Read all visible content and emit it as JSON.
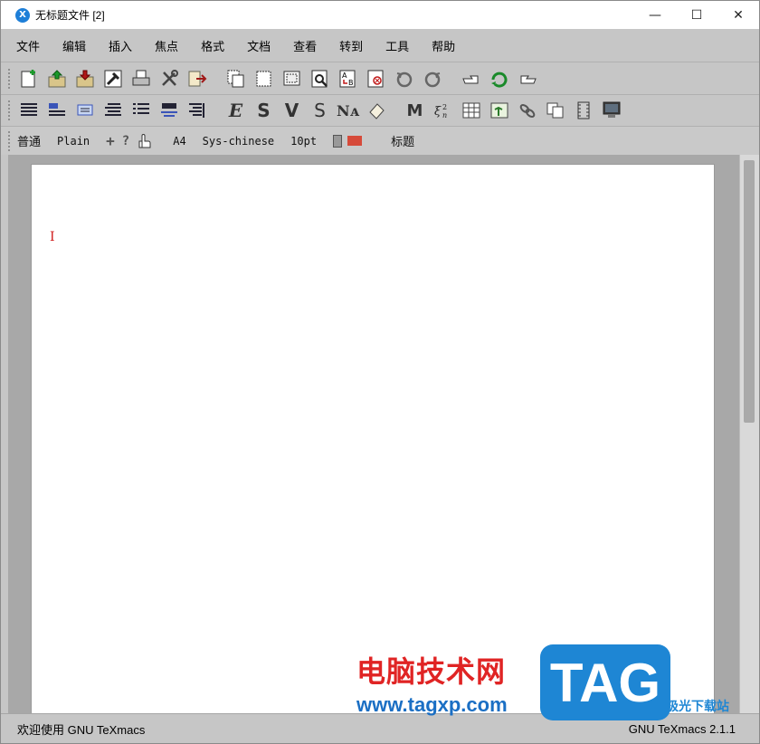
{
  "window": {
    "title": "无标题文件 [2]",
    "app_icon_glyph": "X",
    "controls": {
      "minimize": "—",
      "maximize": "☐",
      "close": "✕"
    }
  },
  "menu": [
    "文件",
    "编辑",
    "插入",
    "焦点",
    "格式",
    "文档",
    "查看",
    "转到",
    "工具",
    "帮助"
  ],
  "toolbar_main": [
    "new-document-icon",
    "open-icon",
    "save-icon",
    "build-icon",
    "print-icon",
    "tools-icon",
    "export-icon",
    "copy-icon",
    "cut-icon",
    "paste-icon",
    "search-icon",
    "replace-icon",
    "spell-check-icon",
    "undo-icon",
    "redo-icon",
    "back-icon",
    "refresh-icon",
    "forward-icon"
  ],
  "toolbar_format": {
    "align_icons": [
      "align-left-icon",
      "align-heading-icon",
      "align-center-icon",
      "align-justify-icon",
      "list-icon",
      "paragraph-icon",
      "align-right-icon"
    ],
    "text_buttons": [
      "E",
      "S",
      "V",
      "S",
      "Nᴀ"
    ],
    "insert_icons": [
      "tag-icon",
      "macro-icon",
      "formula-icon",
      "table-icon",
      "image-icon",
      "link-icon",
      "duplicate-icon",
      "animation-icon",
      "computer-icon"
    ]
  },
  "mode_bar": {
    "style": "普通",
    "font": "Plain",
    "plus": "+",
    "help": "?",
    "paper": "A4",
    "language": "Sys-chinese",
    "font_size": "10pt",
    "section": "标题"
  },
  "canvas": {
    "cursor_glyph": "I"
  },
  "status": {
    "left": "欢迎使用 GNU TeXmacs",
    "right": "GNU TeXmacs 2.1.1"
  },
  "watermark": {
    "cn_text": "电脑技术网",
    "url": "www.tagxp.com",
    "tag": "TAG",
    "site": "极光下载站"
  },
  "colors": {
    "accent": "#1e7fd8",
    "cursor": "#d01a1a",
    "flag_red": "#d64a3a"
  }
}
